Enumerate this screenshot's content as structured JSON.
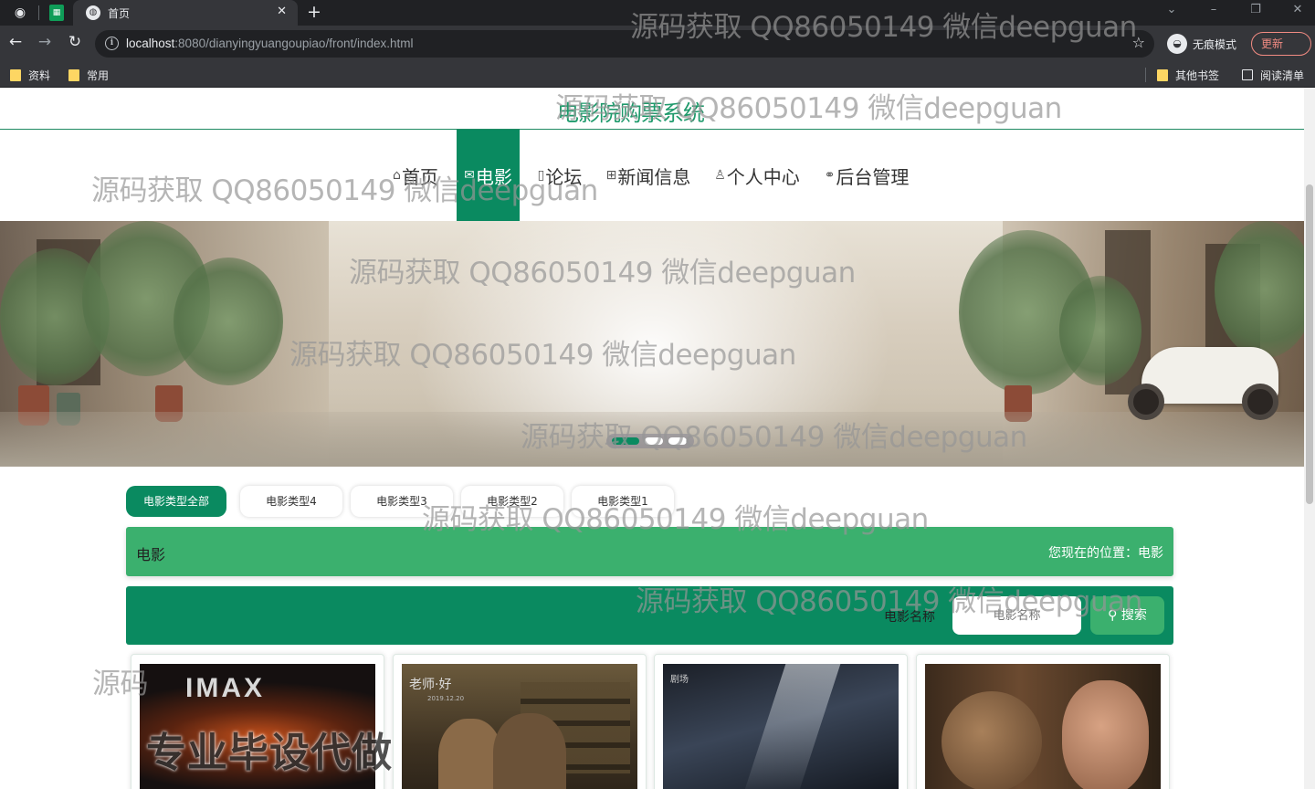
{
  "browser": {
    "tab_title": "首页",
    "url_host": "localhost",
    "url_rest": ":8080/dianyingyuangoupiao/front/index.html",
    "incognito_label": "无痕模式",
    "update_label": "更新",
    "bookmarks": [
      "资料",
      "常用"
    ],
    "other_bookmarks": "其他书签",
    "reading_list": "阅读清单"
  },
  "site": {
    "title": "电影院购票系统",
    "menu": [
      {
        "icon": "home-icon",
        "glyph": "⌂",
        "label": "首页"
      },
      {
        "icon": "mail-icon",
        "glyph": "✉",
        "label": "电影"
      },
      {
        "icon": "doc-icon",
        "glyph": "▯",
        "label": "论坛"
      },
      {
        "icon": "gift-icon",
        "glyph": "⊞",
        "label": "新闻信息"
      },
      {
        "icon": "user-icon",
        "glyph": "♙",
        "label": "个人中心"
      },
      {
        "icon": "link-icon",
        "glyph": "⚭",
        "label": "后台管理"
      }
    ],
    "active_menu": "电影"
  },
  "categories": [
    "电影类型全部",
    "电影类型4",
    "电影类型3",
    "电影类型2",
    "电影类型1"
  ],
  "breadcrumb": {
    "current": "电影",
    "location": "您现在的位置：电影"
  },
  "search": {
    "label": "电影名称",
    "placeholder": "电影名称",
    "button": "搜索"
  },
  "posters": {
    "p1_text": "IMAX",
    "p2_title": "老师·好",
    "p2_date": "2019.12.20",
    "p3_text": "剧场"
  },
  "overlay_text": "专业毕设代做",
  "watermark": "源码获取 QQ86050149 微信deepguan",
  "watermark_short": "源码",
  "colors": {
    "primary": "#0a8a60",
    "accent": "#3bb06e",
    "title": "#1f9a6c"
  }
}
